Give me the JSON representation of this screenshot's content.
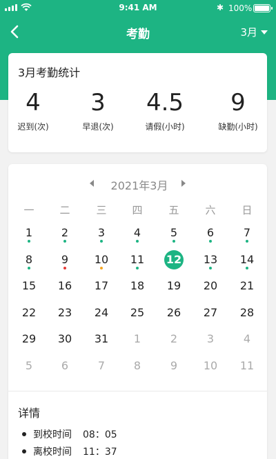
{
  "status": {
    "time": "9:41 AM",
    "battery": "100%"
  },
  "nav": {
    "title": "考勤",
    "month": "3月"
  },
  "stats": {
    "title": "3月考勤统计",
    "items": [
      {
        "value": "4",
        "label": "迟到(次)"
      },
      {
        "value": "3",
        "label": "早退(次)"
      },
      {
        "value": "4.5",
        "label": "请假(小时)"
      },
      {
        "value": "9",
        "label": "缺勤(小时)"
      }
    ]
  },
  "calendar": {
    "year_month": "2021年3月",
    "weekdays": [
      "一",
      "二",
      "三",
      "四",
      "五",
      "六",
      "日"
    ],
    "colors": {
      "normal": "#1db483",
      "abnormal": "#e53935",
      "leave": "#f5a623"
    },
    "days": [
      {
        "d": "1",
        "dot": "normal"
      },
      {
        "d": "2",
        "dot": "normal"
      },
      {
        "d": "3",
        "dot": "normal"
      },
      {
        "d": "4",
        "dot": "normal"
      },
      {
        "d": "5",
        "dot": "normal"
      },
      {
        "d": "6",
        "dot": "normal"
      },
      {
        "d": "7",
        "dot": "normal"
      },
      {
        "d": "8",
        "dot": "normal"
      },
      {
        "d": "9",
        "dot": "abnormal"
      },
      {
        "d": "10",
        "dot": "leave"
      },
      {
        "d": "11",
        "dot": "normal"
      },
      {
        "d": "12",
        "selected": true
      },
      {
        "d": "13",
        "dot": "normal"
      },
      {
        "d": "14",
        "dot": "normal"
      },
      {
        "d": "15"
      },
      {
        "d": "16"
      },
      {
        "d": "17"
      },
      {
        "d": "18"
      },
      {
        "d": "19"
      },
      {
        "d": "20"
      },
      {
        "d": "21"
      },
      {
        "d": "22"
      },
      {
        "d": "23"
      },
      {
        "d": "24"
      },
      {
        "d": "25"
      },
      {
        "d": "26"
      },
      {
        "d": "27"
      },
      {
        "d": "28"
      },
      {
        "d": "29"
      },
      {
        "d": "30"
      },
      {
        "d": "31"
      },
      {
        "d": "1",
        "muted": true
      },
      {
        "d": "2",
        "muted": true
      },
      {
        "d": "3",
        "muted": true
      },
      {
        "d": "4",
        "muted": true
      },
      {
        "d": "5",
        "muted": true
      },
      {
        "d": "6",
        "muted": true
      },
      {
        "d": "7",
        "muted": true
      },
      {
        "d": "8",
        "muted": true
      },
      {
        "d": "9",
        "muted": true
      },
      {
        "d": "10",
        "muted": true
      },
      {
        "d": "11",
        "muted": true
      }
    ]
  },
  "details": {
    "title": "详情",
    "rows": [
      {
        "label": "到校时间",
        "time": "08：05"
      },
      {
        "label": "离校时间",
        "time": "11：37"
      }
    ]
  }
}
